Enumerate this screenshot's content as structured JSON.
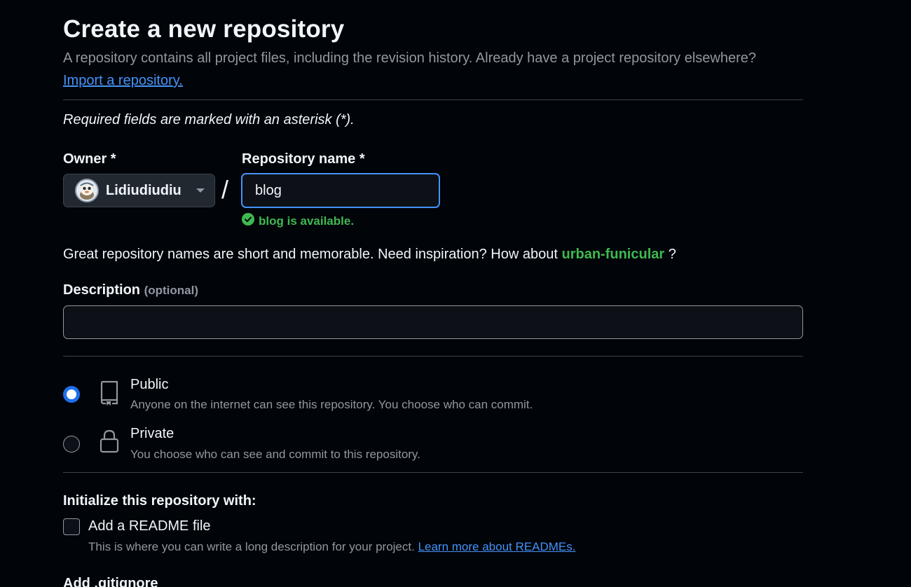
{
  "header": {
    "title": "Create a new repository",
    "subtitle": "A repository contains all project files, including the revision history. Already have a project repository elsewhere?",
    "import_link": "Import a repository."
  },
  "form": {
    "required_note": "Required fields are marked with an asterisk (*).",
    "owner": {
      "label": "Owner *",
      "value": "Lidiudiudiu",
      "avatar_icon": "avatar-icon"
    },
    "separator": "/",
    "repo_name": {
      "label": "Repository name *",
      "value": "blog"
    },
    "availability": "blog is available.",
    "suggestion": {
      "text": "Great repository names are short and memorable. Need inspiration? How about",
      "name": "urban-funicular",
      "suffix": "?"
    },
    "description": {
      "label": "Description",
      "optional": "(optional)",
      "value": ""
    },
    "visibility": {
      "selected": "public",
      "options": [
        {
          "id": "public",
          "title": "Public",
          "desc": "Anyone on the internet can see this repository. You choose who can commit.",
          "icon": "repo-icon"
        },
        {
          "id": "private",
          "title": "Private",
          "desc": "You choose who can see and commit to this repository.",
          "icon": "lock-icon"
        }
      ]
    },
    "initialize": {
      "title": "Initialize this repository with:",
      "readme": {
        "label": "Add a README file",
        "checked": false,
        "desc": "This is where you can write a long description for your project.",
        "link": "Learn more about READMEs."
      },
      "gitignore_label": "Add .gitignore"
    }
  },
  "colors": {
    "background": "#010409",
    "accent": "#4493f8",
    "success": "#3fb950",
    "muted": "#9198a1"
  }
}
